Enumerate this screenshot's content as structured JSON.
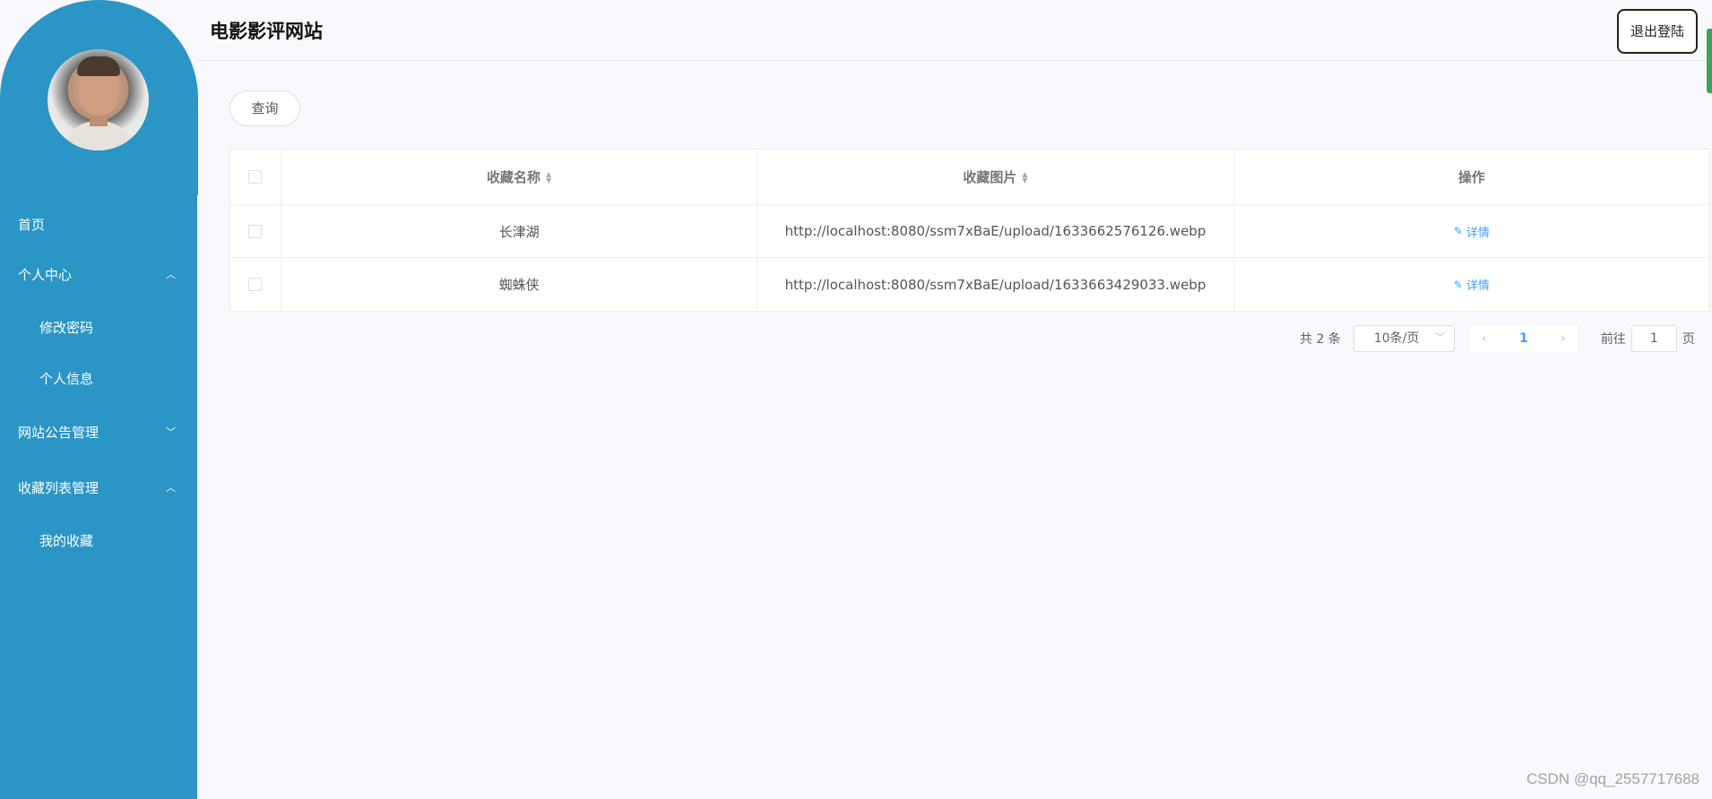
{
  "header": {
    "title": "电影影评网站",
    "logout_label": "退出登陆"
  },
  "sidebar": {
    "items": [
      {
        "label": "首页",
        "type": "item"
      },
      {
        "label": "个人中心",
        "type": "group",
        "arrow": "^"
      },
      {
        "label": "修改密码",
        "type": "sub"
      },
      {
        "label": "个人信息",
        "type": "sub"
      },
      {
        "label": "网站公告管理",
        "type": "group",
        "arrow": "v"
      },
      {
        "label": "收藏列表管理",
        "type": "group",
        "arrow": "^"
      },
      {
        "label": "我的收藏",
        "type": "sub"
      }
    ]
  },
  "toolbar": {
    "query_label": "查询"
  },
  "table": {
    "columns": [
      "收藏名称",
      "收藏图片",
      "操作"
    ],
    "rows": [
      {
        "name": "长津湖",
        "image": "http://localhost:8080/ssm7xBaE/upload/1633662576126.webp",
        "action": "详情"
      },
      {
        "name": "蜘蛛侠",
        "image": "http://localhost:8080/ssm7xBaE/upload/1633663429033.webp",
        "action": "详情"
      }
    ]
  },
  "pagination": {
    "total": "共 2 条",
    "page_size": "10条/页",
    "current_page": "1",
    "goto_label": "前往",
    "goto_value": "1",
    "page_suffix": "页"
  },
  "watermark": "CSDN @qq_2557717688",
  "colors": {
    "sidebar": "#2b95c6",
    "link": "#409eff",
    "background": "#f8f8fd"
  }
}
